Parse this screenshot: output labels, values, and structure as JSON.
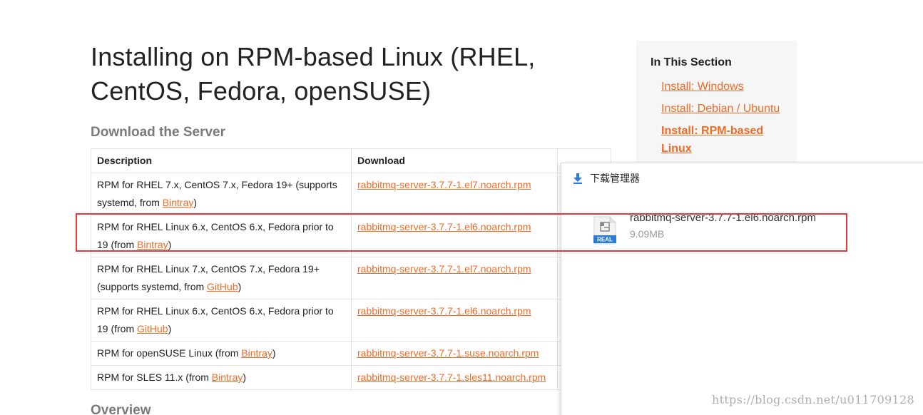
{
  "page": {
    "title": "Installing on RPM-based Linux (RHEL, CentOS, Fedora, openSUSE)",
    "download_heading": "Download the Server",
    "overview_heading": "Overview"
  },
  "table": {
    "headers": [
      "Description",
      "Download",
      ""
    ],
    "rows": [
      {
        "desc_pre": "RPM for RHEL 7.x, CentOS 7.x, Fedora 19+ (supports systemd, from ",
        "desc_link": "Bintray",
        "desc_post": ")",
        "download": "rabbitmq-server-3.7.7-1.el7.noarch.rpm"
      },
      {
        "desc_pre": "RPM for RHEL Linux 6.x, CentOS 6.x, Fedora prior to 19 (from ",
        "desc_link": "Bintray",
        "desc_post": ")",
        "download": "rabbitmq-server-3.7.7-1.el6.noarch.rpm"
      },
      {
        "desc_pre": "RPM for RHEL Linux 7.x, CentOS 7.x, Fedora 19+ (supports systemd, from ",
        "desc_link": "GitHub",
        "desc_post": ")",
        "download": "rabbitmq-server-3.7.7-1.el7.noarch.rpm"
      },
      {
        "desc_pre": "RPM for RHEL Linux 6.x, CentOS 6.x, Fedora prior to 19 (from ",
        "desc_link": "GitHub",
        "desc_post": ")",
        "download": "rabbitmq-server-3.7.7-1.el6.noarch.rpm"
      },
      {
        "desc_pre": "RPM for openSUSE Linux (from ",
        "desc_link": "Bintray",
        "desc_post": ")",
        "download": "rabbitmq-server-3.7.7-1.suse.noarch.rpm"
      },
      {
        "desc_pre": "RPM for SLES 11.x (from ",
        "desc_link": "Bintray",
        "desc_post": ")",
        "download": "rabbitmq-server-3.7.7-1.sles11.noarch.rpm"
      }
    ]
  },
  "sidebar": {
    "title": "In This Section",
    "items": [
      {
        "label": "Install: Windows"
      },
      {
        "label": "Install: Debian / Ubuntu"
      },
      {
        "label": "Install: RPM-based Linux"
      }
    ]
  },
  "download_manager": {
    "title": "下载管理器",
    "file_name": "rabbitmq-server-3.7.7-1.el6.noarch.rpm",
    "file_size": "9.09MB",
    "file_badge": "REAL"
  },
  "watermark": "https://blog.csdn.net/u011709128",
  "colors": {
    "link": "#f26a24",
    "highlight": "#e53935",
    "heading_gray": "#7a7a7a",
    "download_icon": "#2b7cd3"
  }
}
